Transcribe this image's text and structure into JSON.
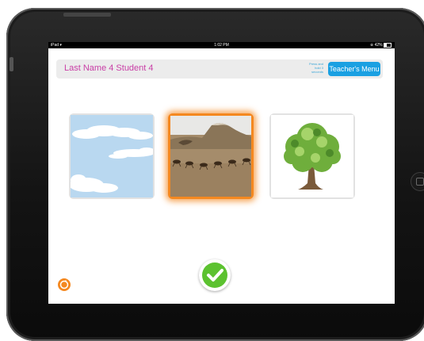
{
  "status_bar": {
    "carrier": "iPad",
    "wifi_icon": "wifi-icon",
    "time": "1:02 PM",
    "battery": "42%"
  },
  "header": {
    "student_name": "Last Name 4 Student 4",
    "press_hold_line1": "Press and",
    "press_hold_line2": "hold 3",
    "press_hold_line3": "seconds",
    "teacher_menu_label": "Teacher's Menu"
  },
  "choices": [
    {
      "image": "sky-with-clouds",
      "selected": false
    },
    {
      "image": "ants-and-anthill",
      "selected": true
    },
    {
      "image": "tree",
      "selected": false
    }
  ],
  "controls": {
    "confirm_icon": "checkmark-icon",
    "reset_icon": "reset-icon"
  },
  "colors": {
    "student_name": "#c93ea6",
    "teacher_menu": "#1aa0e2",
    "selected_border": "#f48820",
    "confirm_green": "#5cc230",
    "reset_orange": "#f48820"
  }
}
